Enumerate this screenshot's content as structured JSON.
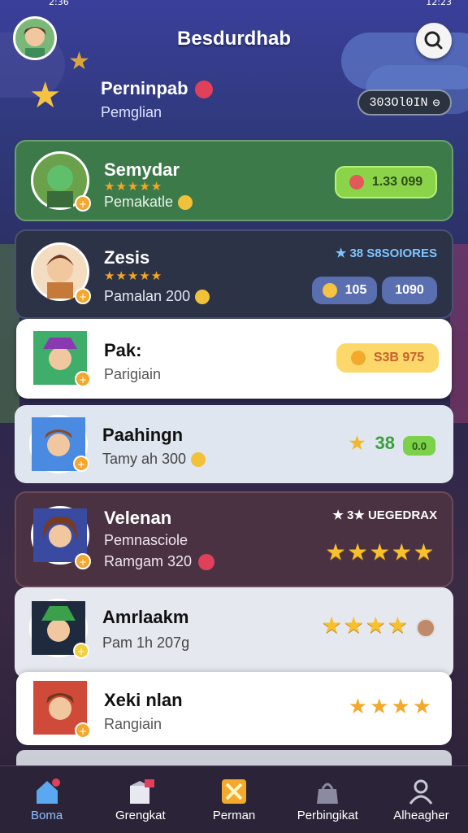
{
  "status": {
    "left": "2:36",
    "right": "12:23"
  },
  "header": {
    "title": "Besdurdhab",
    "avatar": "user-avatar"
  },
  "intro": {
    "title": "Perninpab",
    "subtitle": "Pemglian",
    "pill": "303Ol0IN"
  },
  "cards": [
    {
      "name": "Semydar",
      "line1": "Pemakatle",
      "stars": "★★★★★",
      "pill": "1.33 099",
      "pill_color": "#8bd44a"
    },
    {
      "name": "Zesis",
      "line1": "Pamalan 200",
      "stars": "★★★★★",
      "badge": "★ 38 S8SOIORES",
      "pill_a": "105",
      "pill_b": "1090"
    },
    {
      "name": "Pak:",
      "line1": "Parigiain",
      "pill": "S3B 975"
    },
    {
      "name": "Paahingn",
      "line1": "Tamy ah 300",
      "score": "38",
      "pill": "0.0"
    },
    {
      "name": "Velenan",
      "line1": "Pemnasciole",
      "line2": "Ramgam 320",
      "badge": "★ 3★ UEGEDRAX",
      "stars": "★★★★★"
    },
    {
      "name": "Amrlaakm",
      "line1": "Pam 1h 207g",
      "stars": "★★★★"
    },
    {
      "name": "Xeki nlan",
      "line1": "Rangiain",
      "stars": "★★★★"
    }
  ],
  "nav": [
    {
      "label": "Boma",
      "icon": "home-icon"
    },
    {
      "label": "Grengkat",
      "icon": "box-icon"
    },
    {
      "label": "Perman",
      "icon": "battle-icon"
    },
    {
      "label": "Perbingikat",
      "icon": "bag-icon"
    },
    {
      "label": "Alheagher",
      "icon": "profile-icon"
    }
  ]
}
